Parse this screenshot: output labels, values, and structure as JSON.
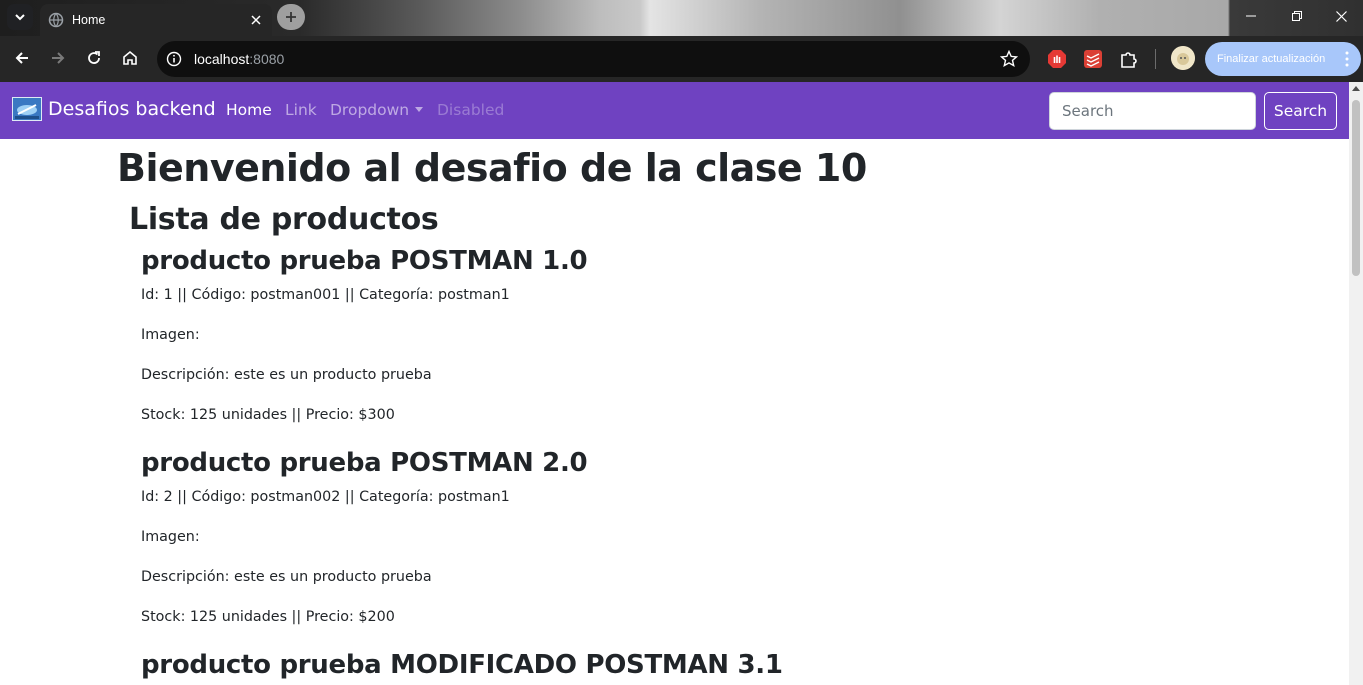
{
  "browser": {
    "tab_title": "Home",
    "url_host": "localhost",
    "url_port": ":8080",
    "update_button": "Finalizar actualización"
  },
  "navbar": {
    "brand": "Desafios backend",
    "links": [
      {
        "label": "Home",
        "state": "active"
      },
      {
        "label": "Link",
        "state": "normal"
      },
      {
        "label": "Dropdown",
        "state": "dropdown"
      },
      {
        "label": "Disabled",
        "state": "disabled"
      }
    ],
    "search_placeholder": "Search",
    "search_button": "Search",
    "color": "#6f42c1"
  },
  "page": {
    "title": "Bienvenido al desafio de la clase 10",
    "subtitle": "Lista de productos",
    "products": [
      {
        "name": "producto prueba POSTMAN 1.0",
        "meta": "Id: 1 || Código: postman001 || Categoría: postman1",
        "image": "Imagen:",
        "description": "Descripción: este es un producto prueba",
        "stock_price": "Stock: 125 unidades || Precio: $300"
      },
      {
        "name": "producto prueba POSTMAN 2.0",
        "meta": "Id: 2 || Código: postman002 || Categoría: postman1",
        "image": "Imagen:",
        "description": "Descripción: este es un producto prueba",
        "stock_price": "Stock: 125 unidades || Precio: $200"
      },
      {
        "name": "producto prueba MODIFICADO POSTMAN 3.1"
      }
    ]
  }
}
